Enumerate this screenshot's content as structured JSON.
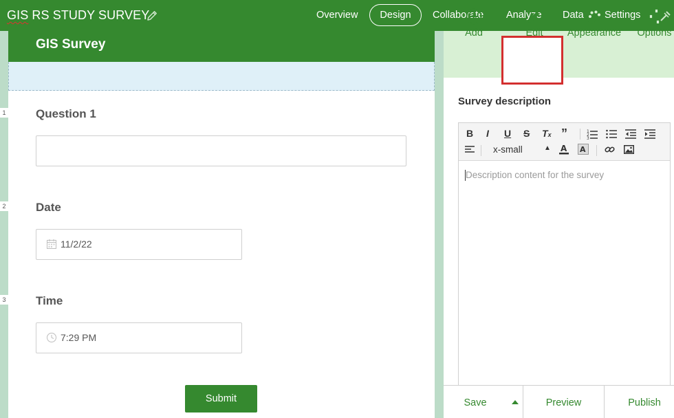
{
  "app": {
    "title_prefix": "GIS",
    "title_rest": " RS STUDY SURVEY"
  },
  "nav": {
    "overview": "Overview",
    "design": "Design",
    "collaborate": "Collaborate",
    "analyze": "Analyze",
    "data": "Data",
    "settings": "Settings"
  },
  "survey": {
    "title": "GIS Survey",
    "questions": [
      {
        "number": "1",
        "label": "Question 1",
        "value": ""
      },
      {
        "number": "2",
        "label": "Date",
        "value": "11/2/22",
        "icon": "calendar-icon"
      },
      {
        "number": "3",
        "label": "Time",
        "value": "7:29 PM",
        "icon": "clock-icon"
      }
    ],
    "submit_label": "Submit"
  },
  "panel": {
    "tools": {
      "add": "Add",
      "edit": "Edit",
      "appearance": "Appearance",
      "options": "Options"
    },
    "section_title": "Survey description",
    "editor": {
      "font_size": "x-small",
      "placeholder": "Description content for the survey"
    },
    "footer": {
      "save": "Save",
      "preview": "Preview",
      "publish": "Publish"
    }
  },
  "colors": {
    "brand_green": "#35892f",
    "toolbar_green": "#d8f0d4",
    "canvas_bg": "#bcdcc8",
    "highlight_red": "#d32f2f"
  }
}
